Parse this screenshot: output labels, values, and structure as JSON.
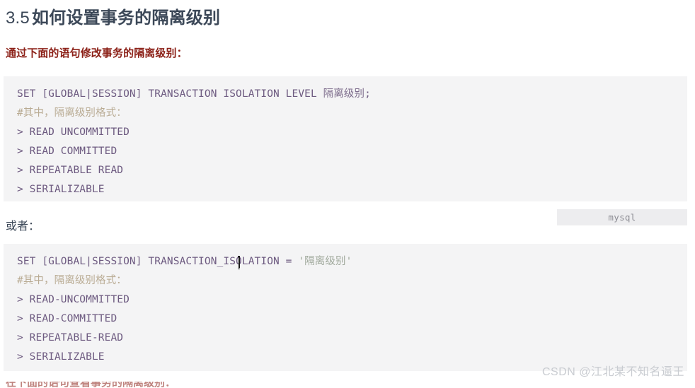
{
  "heading": {
    "number": "3.5",
    "text": "如何设置事务的隔离级别"
  },
  "sub_title": "通过下面的语句修改事务的隔离级别：",
  "code_block_1": {
    "lines": [
      "SET [GLOBAL|SESSION] TRANSACTION ISOLATION LEVEL ",
      "#其中，隔离级别格式：",
      "> READ UNCOMMITTED",
      "> READ COMMITTED",
      "> REPEATABLE READ",
      "> SERIALIZABLE"
    ],
    "line1_keyword": "SET [GLOBAL|SESSION] TRANSACTION ISOLATION LEVEL ",
    "line1_cn": "隔离级别",
    "line1_tail": ";",
    "comment": "#其中，隔离级别格式：",
    "items": [
      "> READ UNCOMMITTED",
      "> READ COMMITTED",
      "> REPEATABLE READ",
      "> SERIALIZABLE"
    ]
  },
  "or_label": "或者：",
  "lang_badge": "mysql",
  "code_block_2": {
    "line1_keyword": "SET [GLOBAL|SESSION] TRANSACTION_ISOLATION = ",
    "line1_str": "'隔离级别'",
    "comment": "#其中，隔离级别格式：",
    "items": [
      "> READ-UNCOMMITTED",
      "> READ-COMMITTED",
      "> REPEATABLE-READ",
      "> SERIALIZABLE"
    ]
  },
  "watermark": "CSDN @江北某不知名逼王",
  "clipped_bottom_text": "在下面的语句查看事务的隔离级别：",
  "colors": {
    "page_background": "#ffffff",
    "heading": "#3c4858",
    "sub_title_red": "#8c2118",
    "code_background": "#f4f4f5",
    "code_text_purple": "#6d5a80",
    "code_comment_tan": "#b9ab93",
    "code_string_gray": "#9fa89b",
    "badge_background": "#ededef",
    "badge_text": "#8d8d94",
    "watermark": "#c9ccd1"
  }
}
